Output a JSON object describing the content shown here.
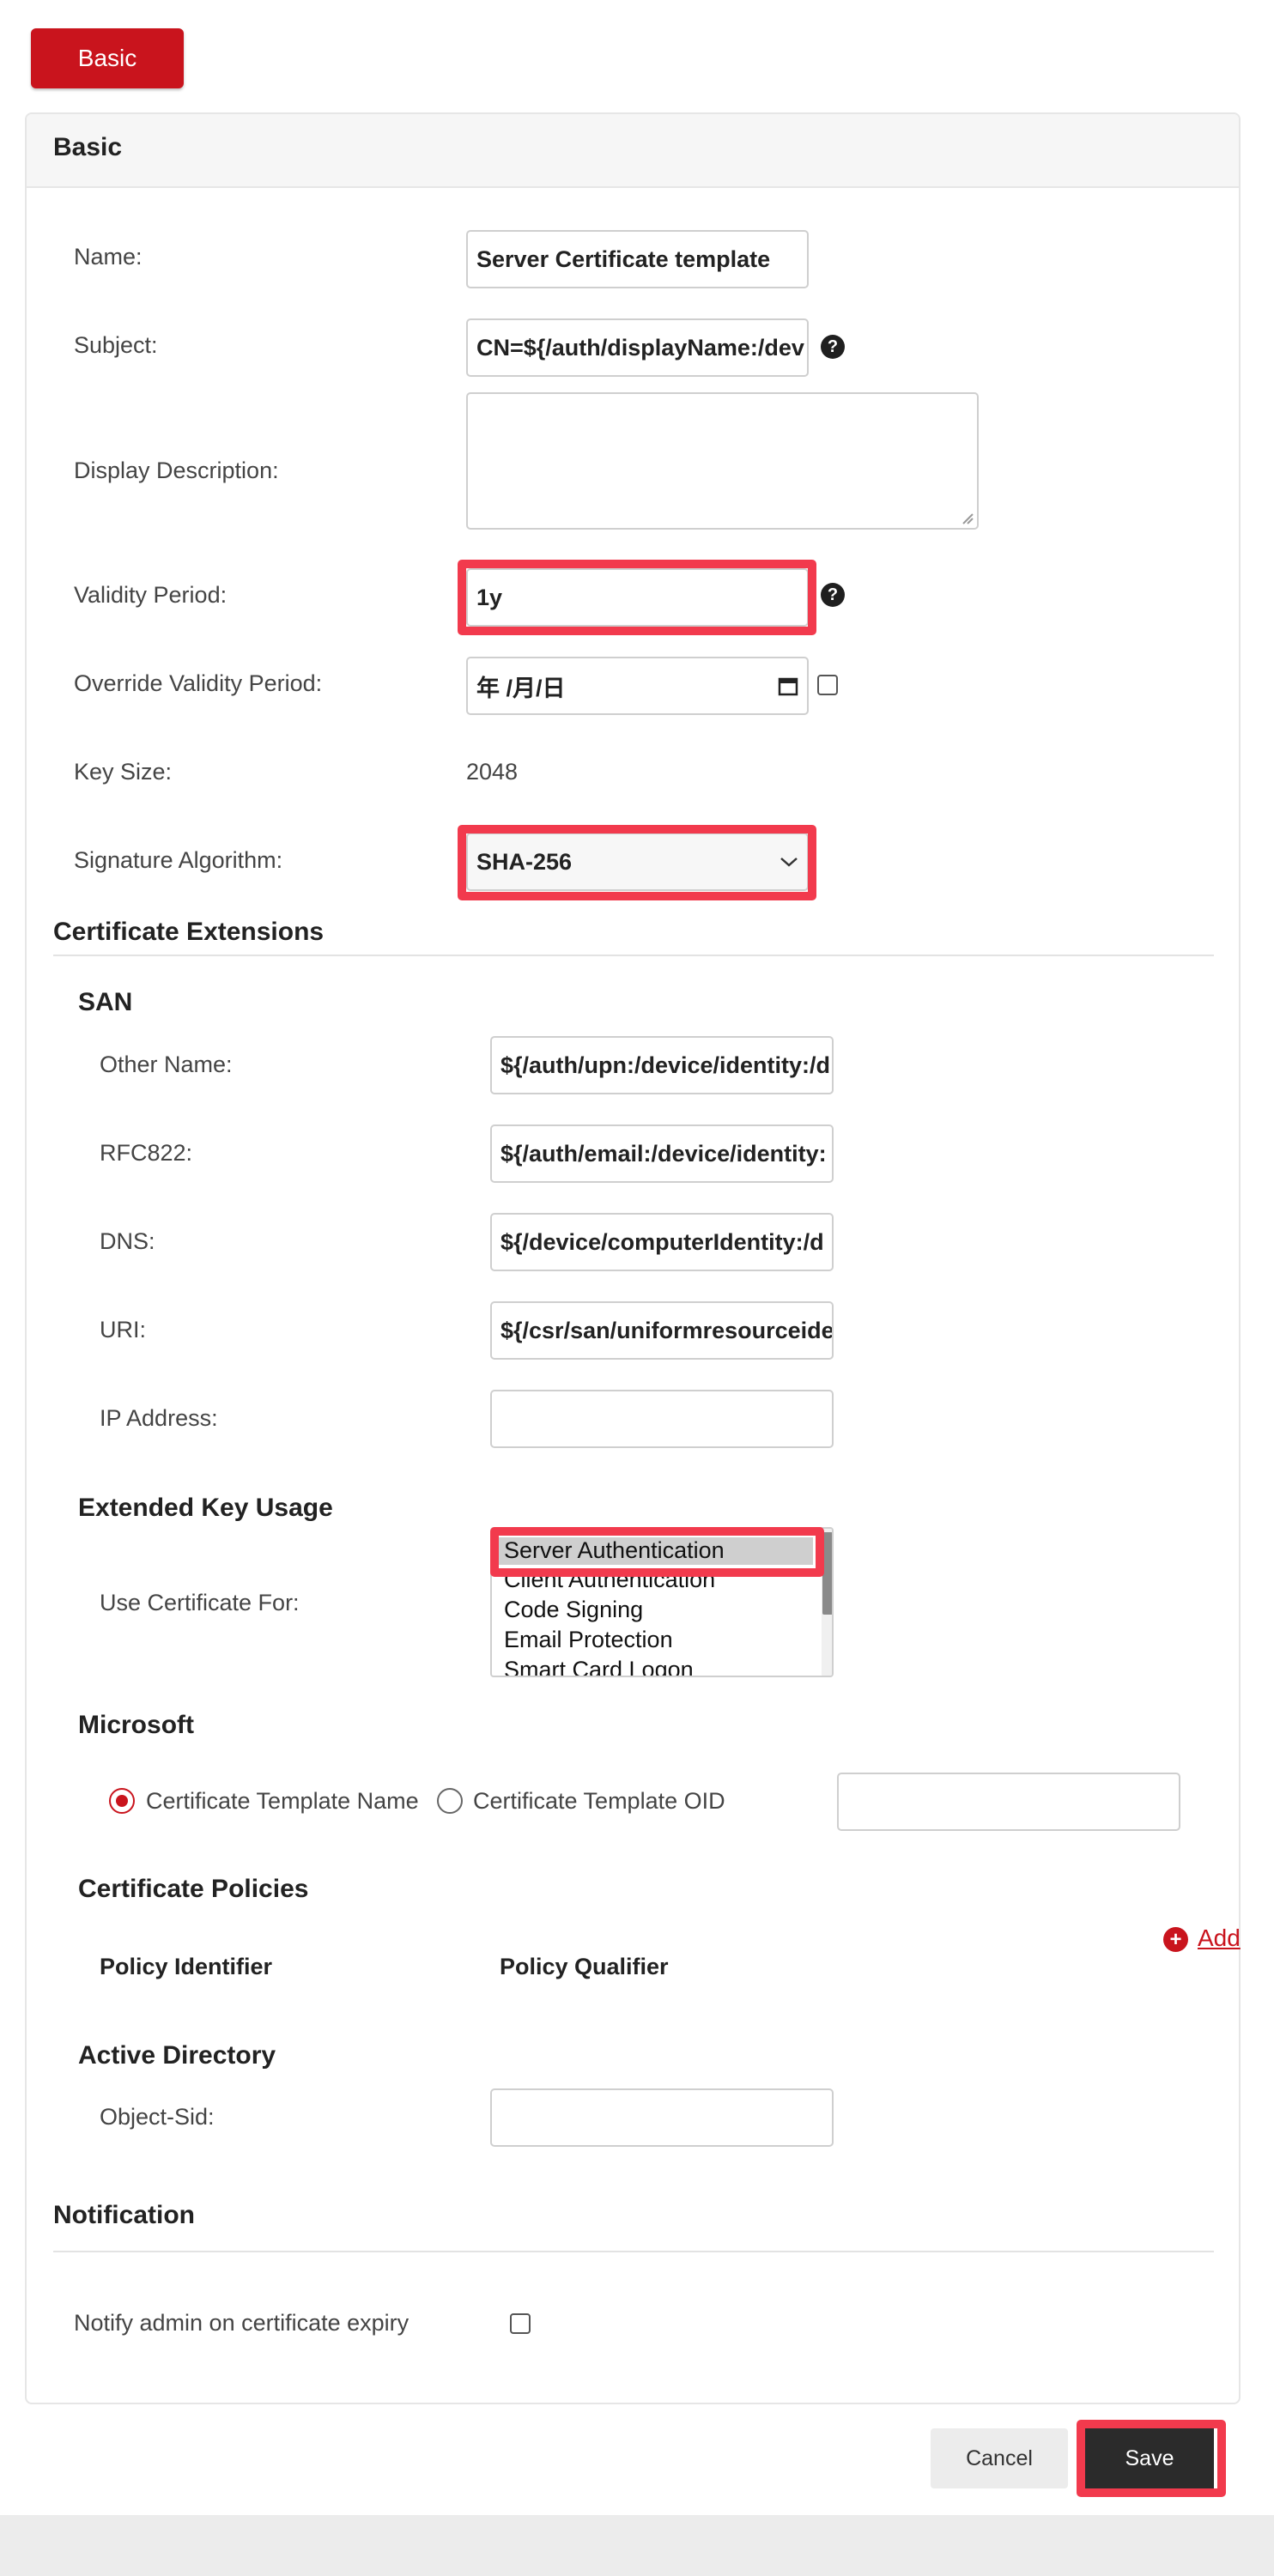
{
  "tab": {
    "label": "Basic"
  },
  "panel": {
    "title": "Basic"
  },
  "form": {
    "name": {
      "label": "Name:",
      "value": "Server Certificate template"
    },
    "subject": {
      "label": "Subject:",
      "value": "CN=${/auth/displayName:/dev"
    },
    "display_description": {
      "label": "Display Description:",
      "value": ""
    },
    "validity_period": {
      "label": "Validity Period:",
      "value": "1y"
    },
    "override_validity": {
      "label": "Override Validity Period:",
      "value": "年 /月/日"
    },
    "key_size": {
      "label": "Key Size:",
      "value": "2048"
    },
    "signature_algorithm": {
      "label": "Signature Algorithm:",
      "value": "SHA-256"
    }
  },
  "cert_ext": {
    "title": "Certificate Extensions",
    "san": {
      "title": "SAN",
      "other_name": {
        "label": "Other Name:",
        "value": "${/auth/upn:/device/identity:/d"
      },
      "rfc822": {
        "label": "RFC822:",
        "value": "${/auth/email:/device/identity:"
      },
      "dns": {
        "label": "DNS:",
        "value": "${/device/computerIdentity:/d"
      },
      "uri": {
        "label": "URI:",
        "value": "${/csr/san/uniformresourceide"
      },
      "ip": {
        "label": "IP Address:",
        "value": ""
      }
    },
    "eku": {
      "title": "Extended Key Usage",
      "label": "Use Certificate For:",
      "options": [
        "Server Authentication",
        "Client Authentication",
        "Code Signing",
        "Email Protection",
        "Smart Card Logon"
      ],
      "selected": "Server Authentication"
    },
    "microsoft": {
      "title": "Microsoft",
      "radio_name": "Certificate Template Name",
      "radio_oid": "Certificate Template OID",
      "value": ""
    },
    "policies": {
      "title": "Certificate Policies",
      "add": "Add",
      "col_identifier": "Policy Identifier",
      "col_qualifier": "Policy Qualifier"
    },
    "ad": {
      "title": "Active Directory",
      "object_sid": {
        "label": "Object-Sid:",
        "value": ""
      }
    }
  },
  "notification": {
    "title": "Notification",
    "notify_label": "Notify admin on certificate expiry"
  },
  "footer": {
    "cancel": "Cancel",
    "save": "Save"
  },
  "colors": {
    "brand_red": "#c9141d",
    "highlight": "#f23a4d",
    "save_bg": "#2b2b2b"
  }
}
